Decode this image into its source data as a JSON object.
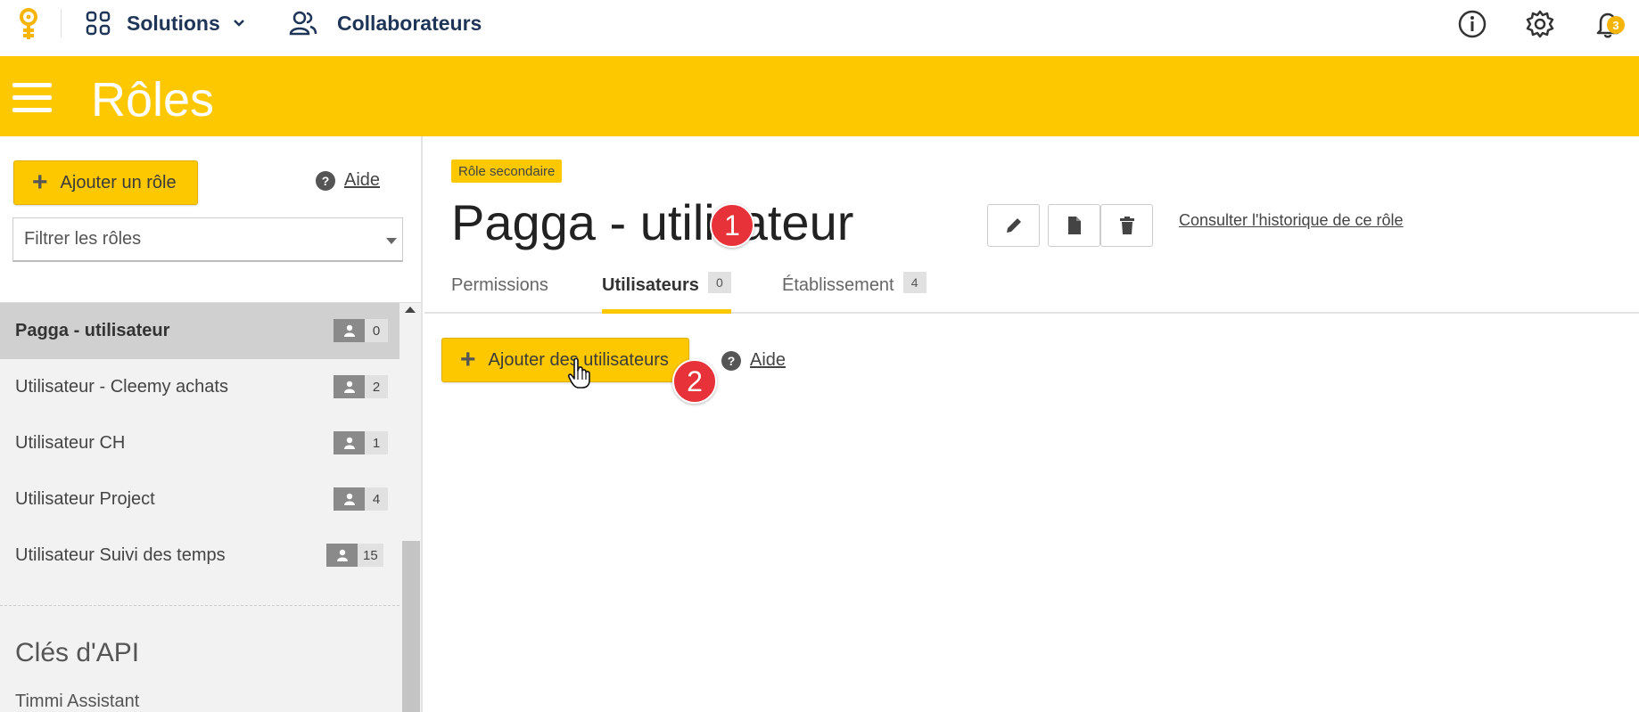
{
  "topbar": {
    "solutions_label": "Solutions",
    "collaborateurs_label": "Collaborateurs",
    "notification_count": "3"
  },
  "header": {
    "title": "Rôles"
  },
  "sidebar": {
    "add_role_label": "Ajouter un rôle",
    "help_label": "Aide",
    "filter_placeholder": "Filtrer les rôles",
    "roles": [
      {
        "name": "Pagga - utilisateur",
        "count": "0"
      },
      {
        "name": "Utilisateur - Cleemy achats",
        "count": "2"
      },
      {
        "name": "Utilisateur CH",
        "count": "1"
      },
      {
        "name": "Utilisateur Project",
        "count": "4"
      },
      {
        "name": "Utilisateur Suivi des temps",
        "count": "15"
      }
    ],
    "api_section_title": "Clés d'API",
    "api_first_item_partial": "Timmi Assistant"
  },
  "main": {
    "role_tag": "Rôle secondaire",
    "role_title": "Pagga - utilisateur",
    "history_link": "Consulter l'historique de ce rôle",
    "tabs": [
      {
        "label": "Permissions",
        "count": ""
      },
      {
        "label": "Utilisateurs",
        "count": "0"
      },
      {
        "label": "Établissement",
        "count": "4"
      }
    ],
    "add_users_label": "Ajouter des utilisateurs",
    "help_label": "Aide",
    "steps": [
      "1",
      "2"
    ]
  },
  "colors": {
    "brand_yellow": "#fdc800",
    "step_red": "#e8323a",
    "nav_text": "#1f3557"
  }
}
